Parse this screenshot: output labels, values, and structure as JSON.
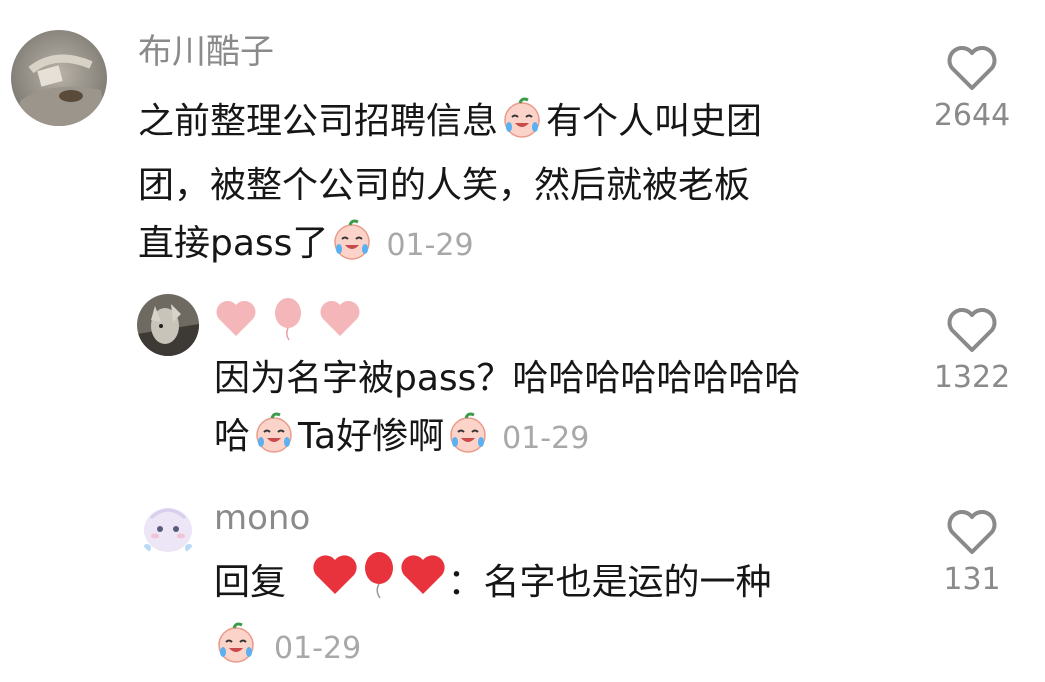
{
  "comments": [
    {
      "username": "布川酷子",
      "text_lines": [
        "之前整理公司招聘信息",
        "有个人叫史团",
        "团，被整个公司的人笑，然后就被老板",
        "直接pass了"
      ],
      "date": "01-29",
      "likes": "2644"
    },
    {
      "username": "",
      "username_icons": [
        "pink-heart-icon",
        "pink-balloon-icon",
        "pink-heart-icon"
      ],
      "text_lines": [
        "因为名字被pass？哈哈哈哈哈哈哈哈",
        "哈",
        "Ta好惨啊"
      ],
      "date": "01-29",
      "likes": "1322"
    },
    {
      "username": "mono",
      "reply_prefix": "回复",
      "reply_to_icons": [
        "red-heart-icon",
        "red-balloon-icon",
        "red-heart-icon"
      ],
      "reply_text": "：名字也是运的一种",
      "date": "01-29",
      "likes": "131"
    }
  ],
  "colors": {
    "username": "#8a8a8a",
    "text": "#161616",
    "date": "#a8a8a8",
    "heart_outline": "#8a8a8a",
    "pink_heart": "#f4b6b8",
    "red_heart": "#e8323c"
  }
}
